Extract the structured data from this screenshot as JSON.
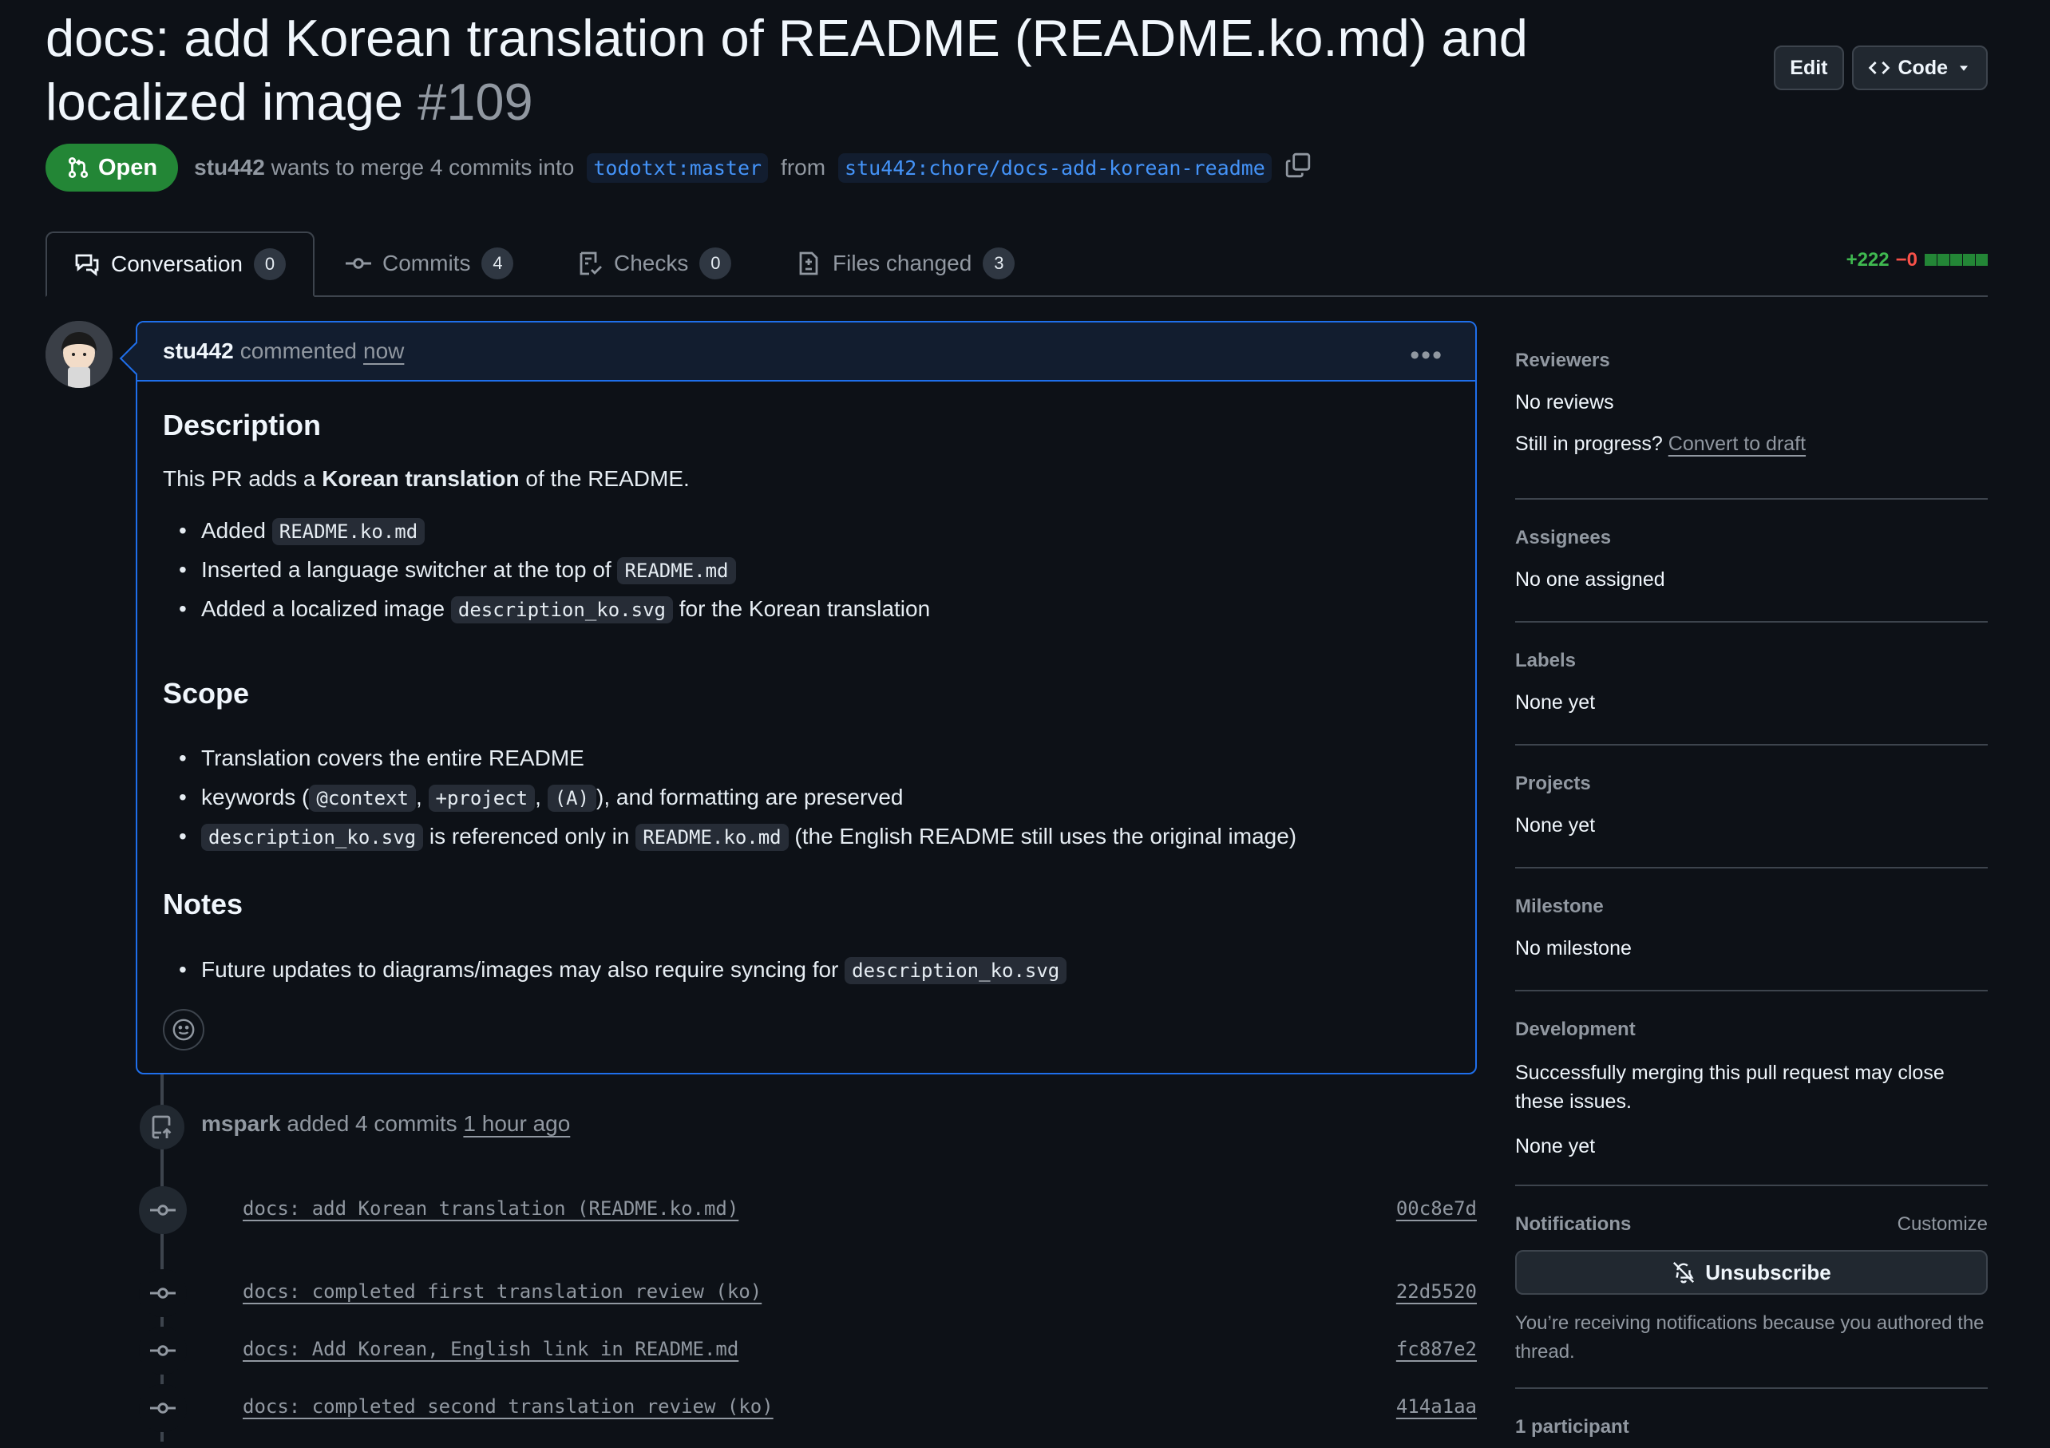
{
  "title": {
    "text": "docs: add Korean translation of README (README.ko.md) and localized image",
    "number": "#109"
  },
  "header_buttons": {
    "edit": "Edit",
    "code": "Code"
  },
  "meta": {
    "status": "Open",
    "author": "stu442",
    "text_merge": "wants to merge 4 commits into",
    "base_branch": "todotxt:master",
    "text_from": "from",
    "head_branch": "stu442:chore/docs-add-korean-readme"
  },
  "tabs": [
    {
      "label": "Conversation",
      "count": "0",
      "icon": "comment-discussion-icon"
    },
    {
      "label": "Commits",
      "count": "4",
      "icon": "git-commit-icon"
    },
    {
      "label": "Checks",
      "count": "0",
      "icon": "checklist-icon"
    },
    {
      "label": "Files changed",
      "count": "3",
      "icon": "file-diff-icon"
    }
  ],
  "diffstat": {
    "additions": "+222",
    "deletions": "−0"
  },
  "comment": {
    "author": "stu442",
    "action": "commented",
    "when": "now",
    "sections": {
      "description": {
        "heading": "Description",
        "intro_pre": "This PR adds a",
        "intro_bold": "Korean translation",
        "intro_post": "of the README.",
        "items": [
          {
            "pre": "Added",
            "code": "README.ko.md",
            "post": ""
          },
          {
            "pre": "Inserted a language switcher at the top of",
            "code": "README.md",
            "post": ""
          },
          {
            "pre": "Added a localized image",
            "code": "description_ko.svg",
            "post": "for the Korean translation"
          }
        ]
      },
      "scope": {
        "heading": "Scope",
        "item1": "Translation covers the entire README",
        "item2_pre": "keywords (",
        "item2_code1": "@context",
        "item2_code2": "+project",
        "item2_code3": "(A)",
        "item2_post": "), and formatting are preserved",
        "item3_code1": "description_ko.svg",
        "item3_mid": "is referenced only in",
        "item3_code2": "README.ko.md",
        "item3_post": "(the English README still uses the original image)"
      },
      "notes": {
        "heading": "Notes",
        "item_pre": "Future updates to diagrams/images may also require syncing for",
        "item_code": "description_ko.svg"
      }
    }
  },
  "push_event": {
    "user": "mspark",
    "text": "added 4 commits",
    "when": "1 hour ago"
  },
  "commits": [
    {
      "message": "docs: add Korean translation (README.ko.md)",
      "sha": "00c8e7d"
    },
    {
      "message": "docs: completed first translation review (ko)",
      "sha": "22d5520"
    },
    {
      "message": "docs: Add Korean, English link in README.md",
      "sha": "fc887e2"
    },
    {
      "message": "docs: completed second translation review (ko)",
      "sha": "414a1aa"
    }
  ],
  "sidebar": {
    "reviewers": {
      "heading": "Reviewers",
      "value": "No reviews",
      "draft_q": "Still in progress?",
      "draft_link": "Convert to draft"
    },
    "assignees": {
      "heading": "Assignees",
      "value": "No one assigned"
    },
    "labels": {
      "heading": "Labels",
      "value": "None yet"
    },
    "projects": {
      "heading": "Projects",
      "value": "None yet"
    },
    "milestone": {
      "heading": "Milestone",
      "value": "No milestone"
    },
    "development": {
      "heading": "Development",
      "desc": "Successfully merging this pull request may close these issues.",
      "value": "None yet"
    },
    "notifications": {
      "heading": "Notifications",
      "customize": "Customize",
      "button": "Unsubscribe",
      "note": "You’re receiving notifications because you authored the thread."
    },
    "participants": {
      "heading": "1 participant"
    }
  },
  "colors": {
    "accent": "#1f6feb",
    "open": "#238636",
    "additions": "#3fb950",
    "deletions": "#f85149"
  }
}
